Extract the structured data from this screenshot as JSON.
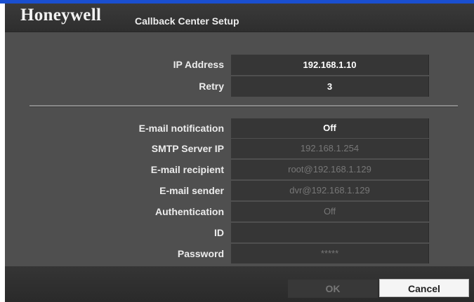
{
  "window": {
    "brand": "Honeywell",
    "title": "Callback Center Setup"
  },
  "network": {
    "ip_address_label": "IP Address",
    "ip_address_value": "192.168.1.10",
    "retry_label": "Retry",
    "retry_value": "3"
  },
  "email": {
    "notification_label": "E-mail notification",
    "notification_value": "Off",
    "smtp_label": "SMTP Server IP",
    "smtp_value": "192.168.1.254",
    "recipient_label": "E-mail recipient",
    "recipient_value": "root@192.168.1.129",
    "sender_label": "E-mail sender",
    "sender_value": "dvr@192.168.1.129",
    "auth_label": "Authentication",
    "auth_value": "Off",
    "id_label": "ID",
    "id_value": "",
    "password_label": "Password",
    "password_value": "*****"
  },
  "buttons": {
    "ok_label": "OK",
    "cancel_label": "Cancel"
  },
  "colors": {
    "accent_strip": "#1a4fd0",
    "panel": "#4f4f4f",
    "field": "#363636"
  }
}
